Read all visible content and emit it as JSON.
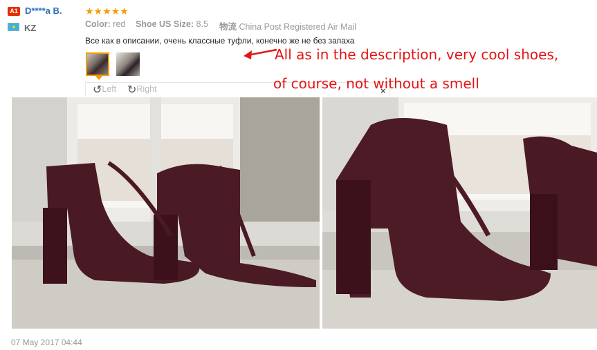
{
  "reviewer": {
    "badge": "A1",
    "name": "D****a B.",
    "country": "KZ"
  },
  "rating": {
    "stars": "★★★★★",
    "value": 5
  },
  "attributes": {
    "color_label": "Color:",
    "color_value": "red",
    "size_label": "Shoe US Size:",
    "size_value": "8.5",
    "shipping_label": "物流",
    "shipping_value": "China Post Registered Air Mail"
  },
  "review_text": "Все как в описании, очень классные туфли, конечно же не без запаха",
  "annotation": {
    "line1": "All as in the description, very cool shoes,",
    "line2": "of course, not without a smell"
  },
  "viewer": {
    "left_label": "Left",
    "right_label": "Right",
    "close_symbol": "×"
  },
  "date": "07 May 2017 04:44",
  "colors": {
    "name_blue": "#2a6ebb",
    "star_orange": "#f29c00",
    "annotation_red": "#e51414"
  }
}
